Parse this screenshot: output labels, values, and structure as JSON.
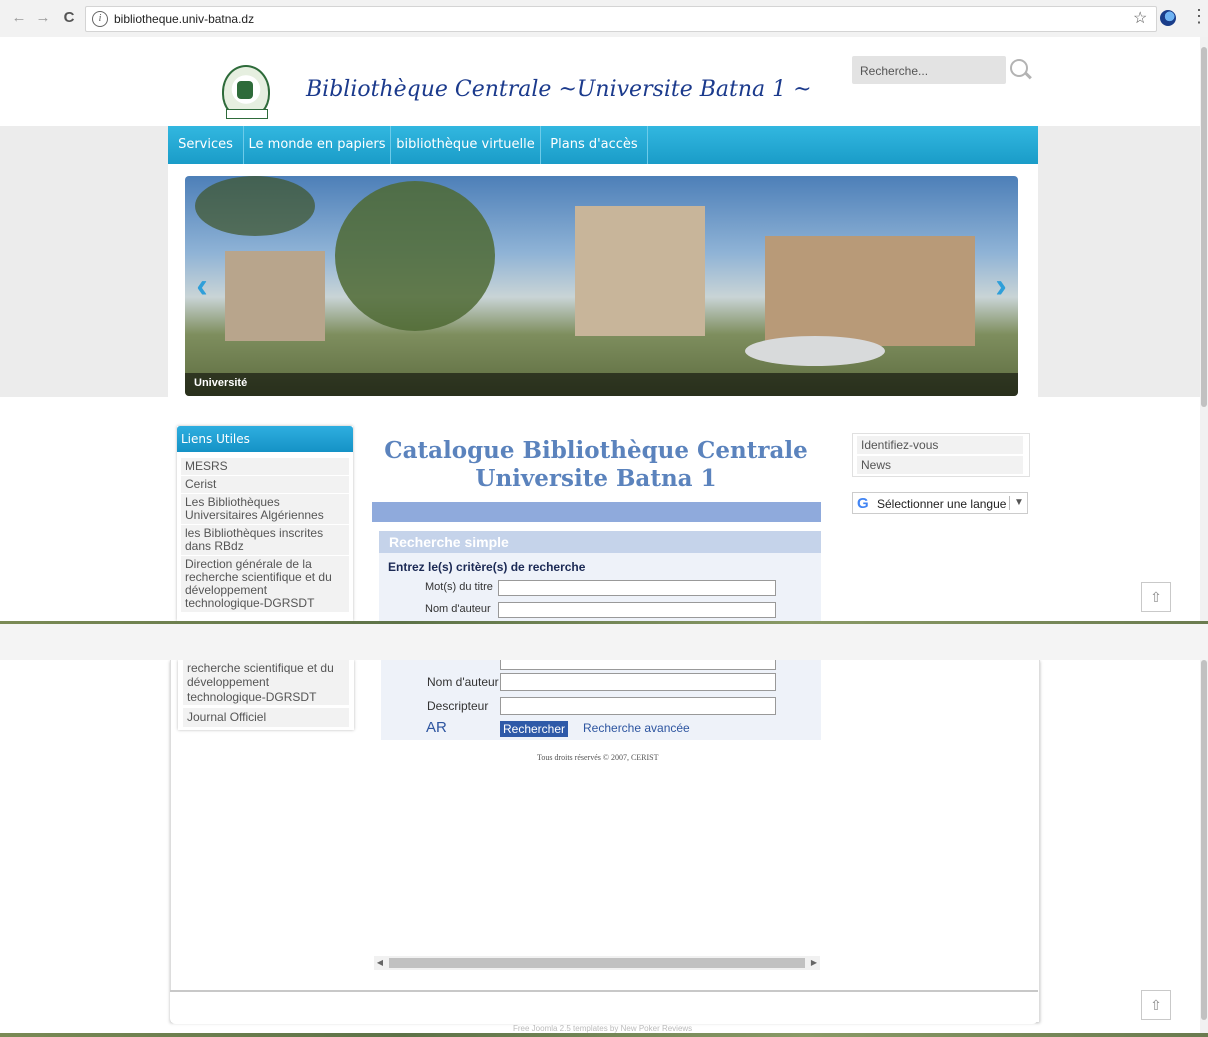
{
  "browser": {
    "url": "bibliotheque.univ-batna.dz",
    "back_icon": "←",
    "forward_icon": "→",
    "reload_icon": "C",
    "info_icon": "i",
    "star_icon": "☆",
    "menu_icon": "⋮"
  },
  "header": {
    "site_title": "Bibliothèque Centrale ~Universite Batna 1 ~",
    "search_placeholder": "Recherche..."
  },
  "nav": {
    "items": [
      "Services",
      "Le monde en papiers",
      "bibliothèque virtuelle",
      "Plans d'accès"
    ]
  },
  "slider": {
    "caption": "Université",
    "prev_icon": "‹",
    "next_icon": "›"
  },
  "links": {
    "title": "Liens Utiles",
    "items": [
      "MESRS",
      "Cerist",
      "Les Bibliothèques Universitaires Algériennes",
      "les Bibliothèques inscrites dans RBdz",
      "Direction générale de la recherche scientifique et du développement technologique-DGRSDT",
      "Journal Officiel"
    ],
    "bottom_fragment_1": "recherche scientifique et du",
    "bottom_fragment_2": "développement",
    "bottom_fragment_3": "technologique-DGRSDT"
  },
  "catalog": {
    "title_line1": "Catalogue Bibliothèque Centrale",
    "title_line2": "Universite Batna 1",
    "section": "Recherche simple",
    "criteria": "Entrez le(s) critère(s) de recherche",
    "label_title": "Mot(s) du titre",
    "label_author": "Nom d'auteur",
    "label_descriptor": "Descripteur",
    "ar_link": "AR",
    "search_button": "Rechercher",
    "advanced_link": "Recherche avancée",
    "copyright": "Tous droits réservés © 2007, CERIST"
  },
  "side": {
    "login": "Identifiez-vous",
    "news": "News",
    "language": "Sélectionner une langue",
    "language_caret": "▼",
    "google_letter": "G"
  },
  "footer": {
    "credit": "Free Joomla 2.5 templates by New Poker Reviews",
    "scroll_top_icon": "⇧"
  },
  "colors": {
    "nav_blue": "#1a9cc8",
    "title_blue": "#5b83bd",
    "button_blue": "#2f5aa8"
  }
}
